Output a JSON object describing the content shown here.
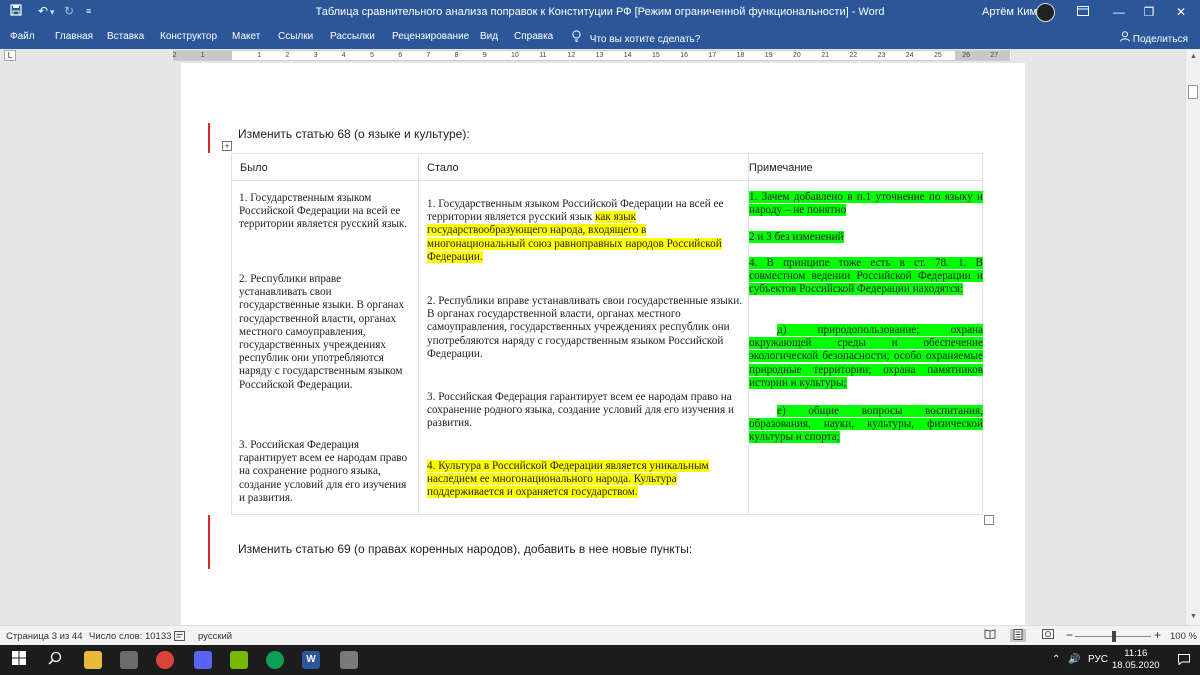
{
  "window": {
    "title": "Таблица сравнительного анализа поправок к Конституции РФ [Режим ограниченной функциональности] - Word",
    "user": "Артём Ким"
  },
  "quick_access": {
    "save_icon": "save-icon",
    "undo_icon": "undo-icon",
    "redo_icon": "redo-icon",
    "customize_icon": "chevron-down-icon"
  },
  "ribbon": {
    "tabs": [
      "Файл",
      "Главная",
      "Вставка",
      "Конструктор",
      "Макет",
      "Ссылки",
      "Рассылки",
      "Рецензирование",
      "Вид",
      "Справка"
    ],
    "tell_me": "Что вы хотите сделать?",
    "share": "Поделиться"
  },
  "ruler": {
    "corner": "L",
    "numbers": [
      "2",
      "1",
      "1",
      "2",
      "3",
      "4",
      "5",
      "6",
      "7",
      "8",
      "9",
      "10",
      "11",
      "12",
      "13",
      "14",
      "15",
      "16",
      "17",
      "18",
      "19",
      "20",
      "21",
      "22",
      "23",
      "24",
      "25",
      "26",
      "27"
    ]
  },
  "document": {
    "para1": "Изменить статью 68 (о языке и культуре):",
    "para2": "Изменить статью 69 (о правах коренных народов), добавить в нее новые пункты:",
    "table_handle": "+",
    "table": {
      "headers": [
        "Было",
        "Стало",
        "Примечание"
      ],
      "was": [
        "1. Государственным языком Российской Федерации на всей ее территории является русский язык.",
        "2. Республики вправе устанавливать свои государственные языки. В органах государственной власти, органах местного самоуправления, государственных учреждениях республик они употребляются наряду с государственным языком Российской Федерации.",
        "3. Российская Федерация гарантирует всем ее народам право на сохранение родного языка, создание условий для его изучения и развития."
      ],
      "became": {
        "p1_plain": "1. Государственным языком Российской Федерации на всей ее территории является русский язык ",
        "p1_highlight": "как язык государствообразующего народа, входящего в многонациональный союз равноправных народов Российской Федерации.",
        "p2": "2. Республики вправе устанавливать свои государственные языки. В органах государственной власти, органах местного самоуправления, государственных учреждениях республик они употребляются наряду с государственным языком Российской Федерации.",
        "p3": "3. Российская Федерация гарантирует всем ее народам право на сохранение родного языка, создание условий для его изучения и развития.",
        "p4_highlight": "4. Культура в Российской Федерации является уникальным наследием ее многонационального народа. Культура поддерживается и охраняется государством."
      },
      "note": {
        "n1": "1. Зачем добавлено в п.1 уточнение по языку и народу – не понятно",
        "n2": "2 и 3 без изменений",
        "n3": "4. В принципе тоже есть в ст. 78. 1. В совместном ведении Российской Федерации и субъектов Российской Федерации находятся:",
        "n4": "д) природопользование; охрана окружающей среды и обеспечение экологической безопасности; особо охраняемые природные территории; охрана памятников истории и культуры;",
        "n5": "е) общие вопросы воспитания, образования, науки, культуры, физической культуры и спорта;"
      }
    }
  },
  "statusbar": {
    "page": "Страница 3 из 44",
    "words": "Число слов: 10133",
    "language": "русский",
    "zoom": "100 %",
    "zoom_minus": "−",
    "zoom_plus": "+"
  },
  "taskbar": {
    "language": "РУС",
    "time": "11:16",
    "date": "18.05.2020"
  },
  "colors": {
    "word_blue": "#2b579a",
    "highlight_yellow": "#ffff00",
    "highlight_green": "#00ff00",
    "change_bar": "#d9282b"
  }
}
